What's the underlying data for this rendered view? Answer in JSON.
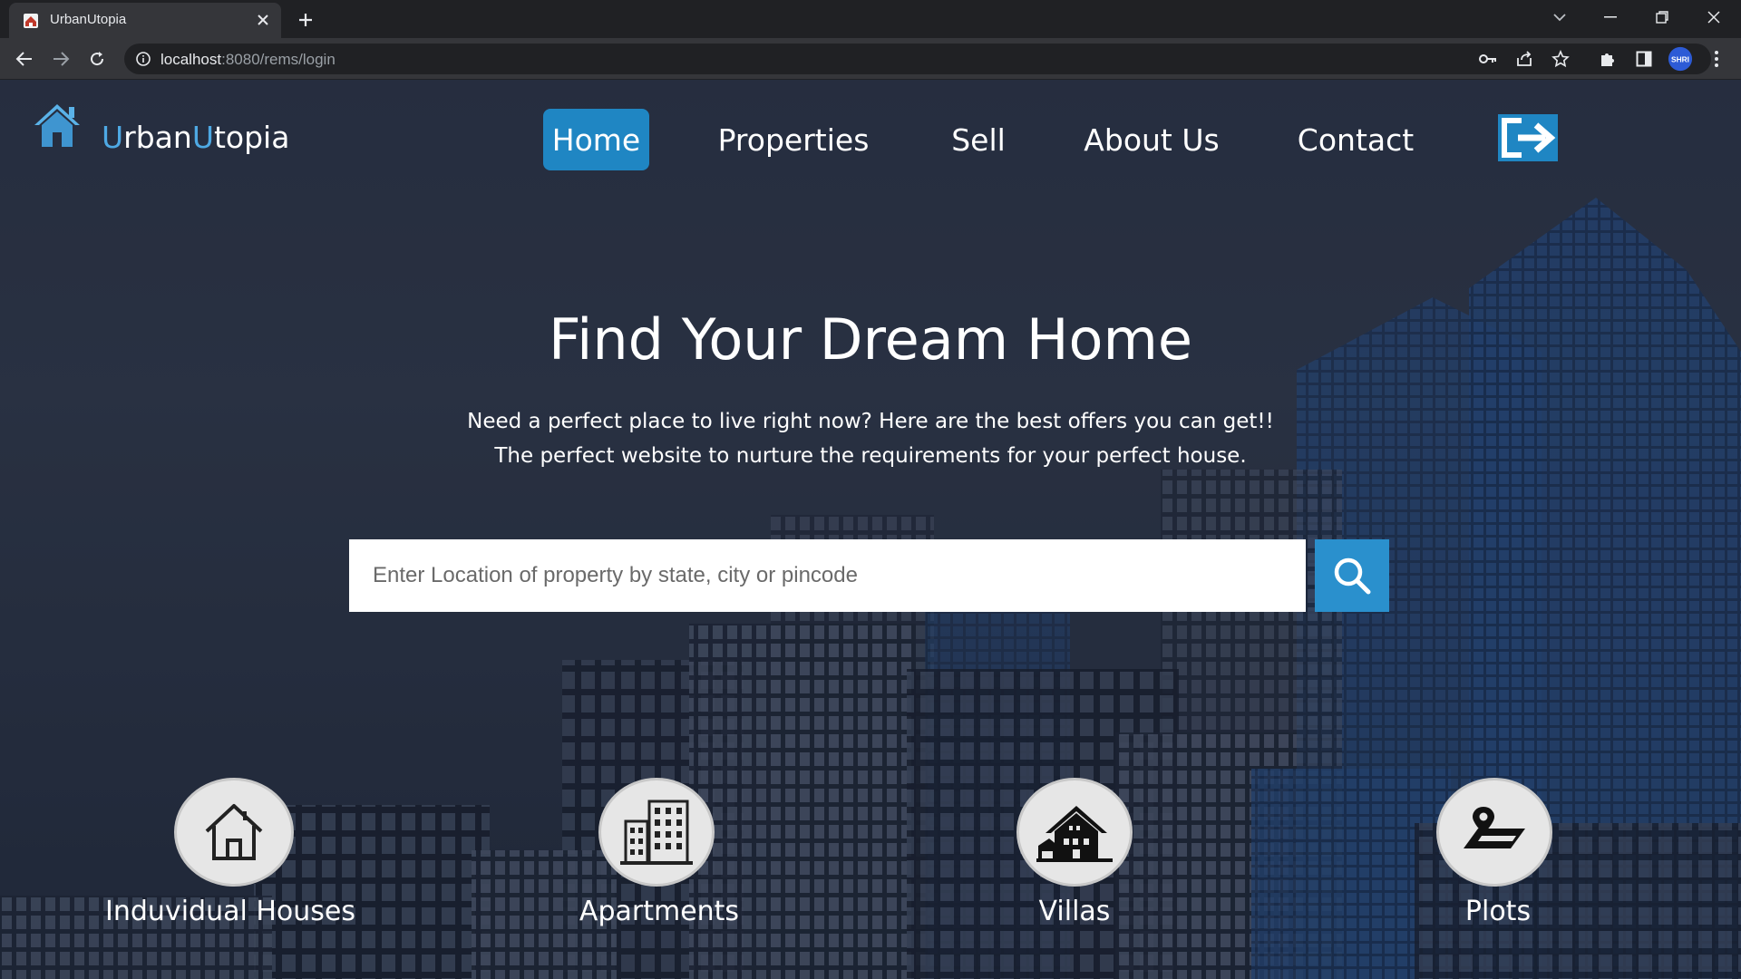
{
  "browser": {
    "tab_title": "UrbanUtopia",
    "url_host": "localhost",
    "url_rest": ":8080/rems/login"
  },
  "site": {
    "brand_first": "U",
    "brand_mid": "rban",
    "brand_second": "U",
    "brand_last": "topia",
    "accent_color": "#1f86c3",
    "brand_color": "#4ea9e4"
  },
  "nav": {
    "home": "Home",
    "properties": "Properties",
    "sell": "Sell",
    "about": "About Us",
    "contact": "Contact"
  },
  "hero": {
    "title": "Find Your Dream Home",
    "subtitle_line1": "Need a perfect place to live right now? Here are the best offers you can get!!",
    "subtitle_line2": "The perfect website to nurture the requirements for your perfect house."
  },
  "search": {
    "placeholder": "Enter Location of property by state, city or pincode"
  },
  "categories": [
    {
      "label": "Induvidual Houses",
      "icon": "house-icon"
    },
    {
      "label": "Apartments",
      "icon": "apartment-building-icon"
    },
    {
      "label": "Villas",
      "icon": "villa-icon"
    },
    {
      "label": "Plots",
      "icon": "plot-location-icon"
    }
  ]
}
